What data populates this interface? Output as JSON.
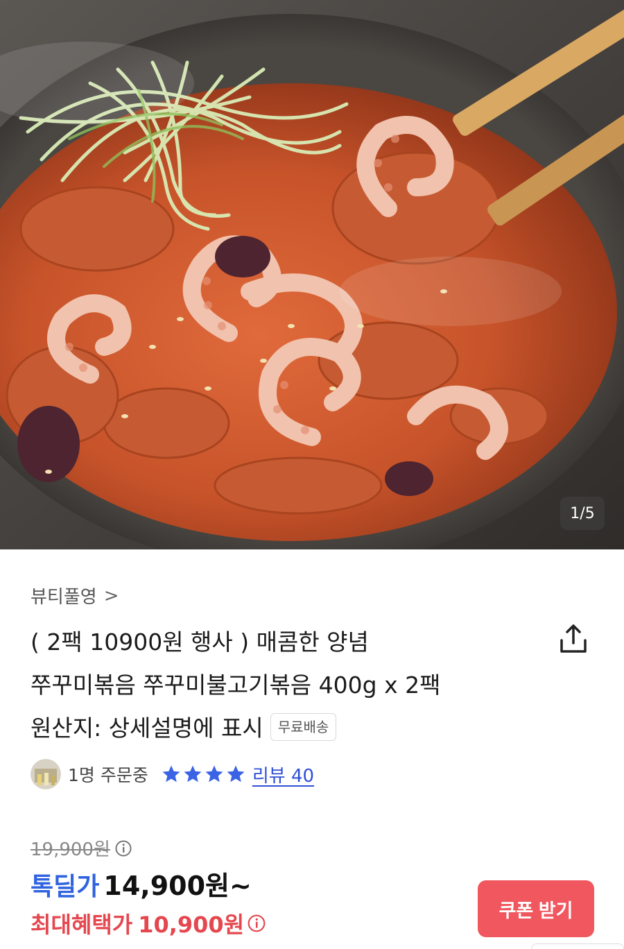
{
  "gallery": {
    "page_indicator": "1/5",
    "image_icon": "spicy-stir-fried-webfoot-octopus-photo"
  },
  "product": {
    "seller": "뷰티풀영",
    "seller_chevron": ">",
    "title_lines": [
      "( 2팩 10900원 행사 ) 매콤한 양념",
      "쭈꾸미볶음 쭈꾸미불고기볶음 400g x 2팩",
      "원산지: 상세설명에 표시"
    ],
    "shipping_badge": "무료배송",
    "share_icon": "share-icon"
  },
  "social": {
    "order_count": "1명 주문중",
    "rating_stars": 4,
    "review_label": "리뷰 40"
  },
  "pricing": {
    "original_price": "19,900원",
    "deal_label": "톡딜가",
    "deal_price": "14,900원~",
    "max_benefit_label": "최대혜택가",
    "max_benefit_price": "10,900원"
  },
  "actions": {
    "coupon_button": "쿠폰 받기"
  },
  "colors": {
    "deal_blue": "#2f63e0",
    "benefit_red": "#e5474f",
    "coupon_bg": "#f0575e",
    "review_blue": "#2f4fd6",
    "star_blue": "#3a63e6"
  }
}
